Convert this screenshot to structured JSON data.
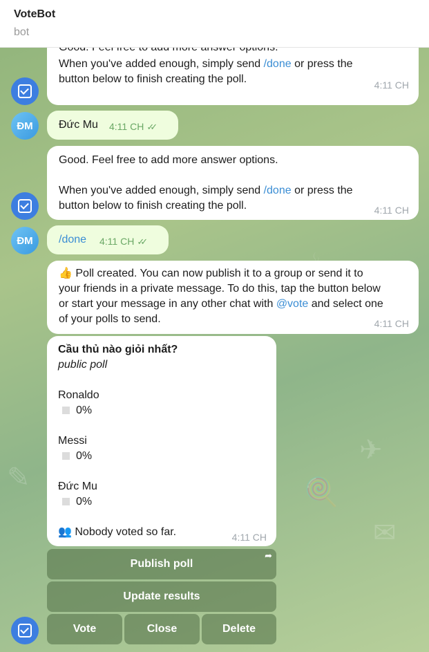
{
  "header": {
    "title": "VoteBot",
    "subtitle": "bot"
  },
  "messages": [
    {
      "line1": "Good. Feel free to add more answer options.",
      "line2a": "When you've added enough, simply send ",
      "link": "/done",
      "line2b": " or press the",
      "line3": "button below to finish creating the poll.",
      "time": "4:11 CH"
    },
    {
      "avatar": "ĐM",
      "text": "Đức Mu",
      "time": "4:11 CH"
    },
    {
      "line1": "Good. Feel free to add more answer options.",
      "line2a": "When you've added enough, simply send ",
      "link": "/done",
      "line2b": " or press the",
      "line3": "button below to finish creating the poll.",
      "time": "4:11 CH"
    },
    {
      "avatar": "ĐM",
      "text": "/done",
      "time": "4:11 CH"
    },
    {
      "emoji": "👍",
      "line1": " Poll created. You can now publish it to a group or send it to",
      "line2": "your friends in a private message. To do this, tap the button below",
      "line3": "or start your message in any other chat with ",
      "mention": "@vote",
      "line3b": " and select one",
      "line4": "of your polls to send.",
      "time": "4:11 CH"
    }
  ],
  "poll": {
    "question": "Cầu thủ nào giỏi nhất?",
    "type": "public poll",
    "options": [
      {
        "name": "Ronaldo",
        "percent": "0%"
      },
      {
        "name": "Messi",
        "percent": "0%"
      },
      {
        "name": "Đức Mu",
        "percent": "0%"
      }
    ],
    "footer_icon": "👥",
    "footer": " Nobody voted so far.",
    "time": "4:11 CH"
  },
  "keyboard": {
    "publish": "Publish poll",
    "update": "Update results",
    "vote": "Vote",
    "close": "Close",
    "delete": "Delete"
  }
}
